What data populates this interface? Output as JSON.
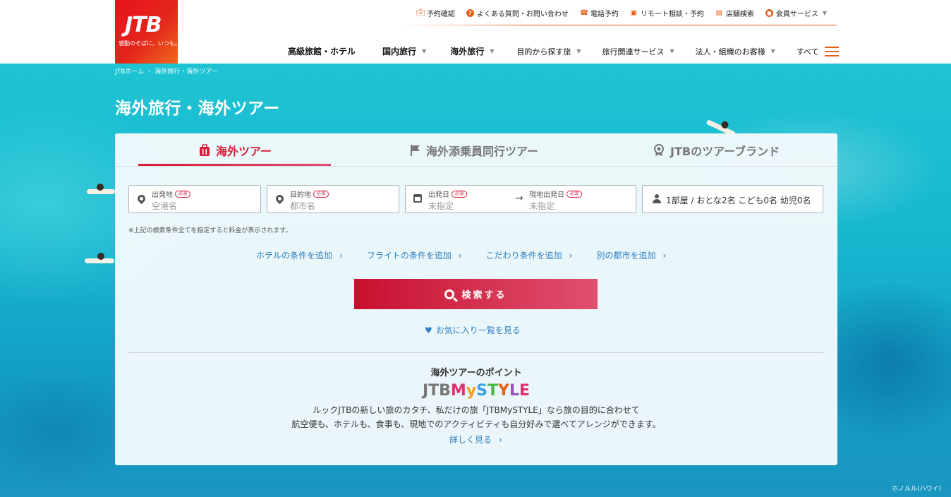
{
  "brand": {
    "logo_text": "JTB",
    "tagline": "感動のそばに、いつも。"
  },
  "utility_nav": [
    {
      "label": "予約確認",
      "icon": "suitcase-icon"
    },
    {
      "label": "よくある質問・お問い合わせ",
      "icon": "question-icon"
    },
    {
      "label": "電話予約",
      "icon": "phone-icon"
    },
    {
      "label": "リモート相談・予約",
      "icon": "monitor-icon"
    },
    {
      "label": "店舗検索",
      "icon": "store-icon"
    },
    {
      "label": "会員サービス",
      "icon": "user-icon"
    }
  ],
  "global_nav": [
    {
      "label": "高級旅館・ホテル"
    },
    {
      "label": "国内旅行"
    },
    {
      "label": "海外旅行"
    },
    {
      "label": "目的から探す旅"
    },
    {
      "label": "旅行関連サービス"
    },
    {
      "label": "法人・組織のお客様"
    },
    {
      "label": "すべて"
    }
  ],
  "breadcrumb": [
    "JTBホーム",
    "海外旅行・海外ツアー"
  ],
  "page_title": "海外旅行・海外ツアー",
  "tabs": [
    {
      "label": "海外ツアー",
      "icon": "luggage-icon",
      "active": true
    },
    {
      "label": "海外添乗員同行ツアー",
      "icon": "flag-icon",
      "active": false
    },
    {
      "label": "JTBのツアーブランド",
      "icon": "award-icon",
      "active": false
    }
  ],
  "form": {
    "required_badge": "必須",
    "origin": {
      "label": "出発地",
      "placeholder": "空港名"
    },
    "destination": {
      "label": "目的地",
      "placeholder": "都市名"
    },
    "departure_date": {
      "label": "出発日",
      "placeholder": "未指定"
    },
    "local_departure_date": {
      "label": "現地出発日",
      "placeholder": "未指定"
    },
    "guests": "1部屋 / おとな2名 こども0名 幼児0名",
    "note": "※上記の検索条件全てを指定すると料金が表示されます。"
  },
  "add_links": [
    "ホテルの条件を追加",
    "フライトの条件を追加",
    "こだわり条件を追加",
    "別の都市を追加"
  ],
  "search_button": "検索する",
  "favorites_link": "お気に入り一覧を見る",
  "points": {
    "title": "海外ツアーのポイント",
    "brand_logo": "JTBMySTYLE",
    "desc_line1": "ルックJTBの新しい旅のカタチ、私だけの旅「JTBMySTYLE」なら旅の目的に合わせて",
    "desc_line2": "航空便も、ホテルも、食事も、現地でのアクティビティも自分好みで選べてアレンジができます。",
    "more_link": "詳しく見る"
  },
  "photo_credit": "ホノルル(ハワイ)",
  "colors": {
    "accent": "#d41e3a",
    "orange": "#e85d18",
    "link": "#2c7fc2"
  }
}
